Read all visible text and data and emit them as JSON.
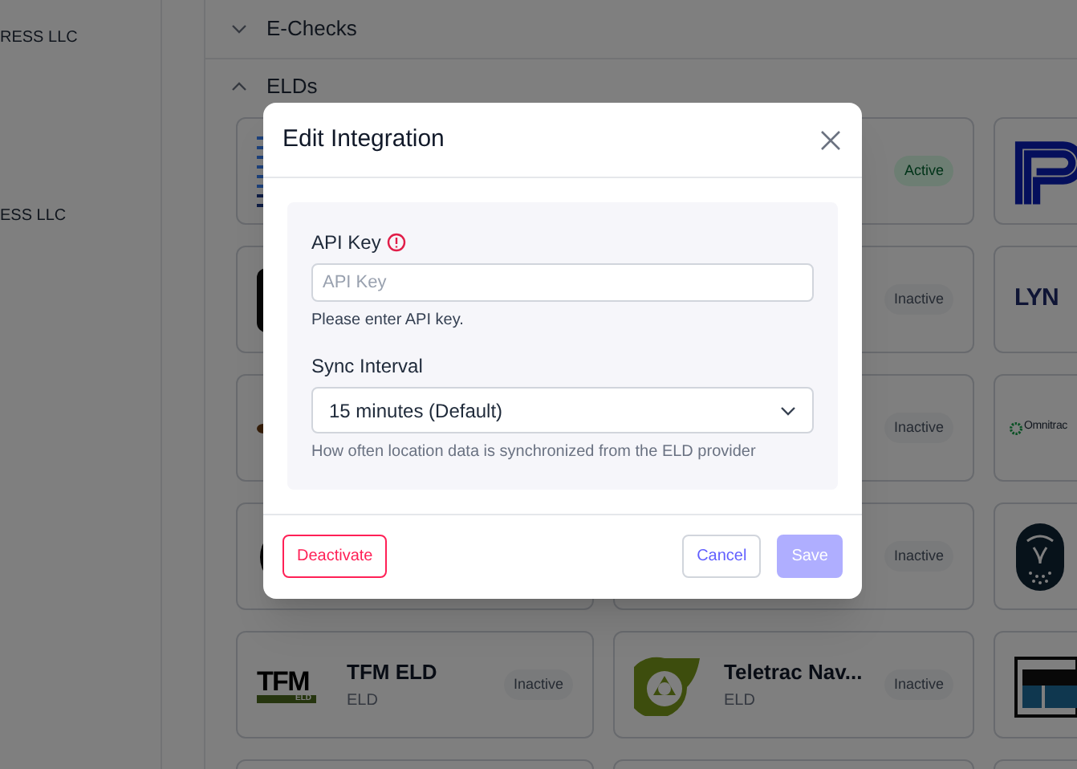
{
  "sidebar": {
    "items": [
      {
        "label": "RESS LLC"
      },
      {
        "label": "ESS LLC"
      }
    ]
  },
  "sections": [
    {
      "title": "E-Checks",
      "expanded": false
    },
    {
      "title": "ELDs",
      "expanded": true,
      "cards": [
        {
          "kind": "stripes"
        },
        {
          "status": "Active",
          "active": true
        },
        {
          "kind": "pmark"
        },
        {
          "kind": "darksquare"
        },
        {
          "status": "Inactive",
          "active": false
        },
        {
          "kind": "textmark",
          "logo_text": "LYN"
        },
        {
          "kind": "brownmark"
        },
        {
          "status": "Inactive",
          "active": false
        },
        {
          "kind": "flowermark",
          "logo_text": "Omnitrac"
        },
        {
          "kind": "darkround"
        },
        {
          "status": "Inactive",
          "active": false
        },
        {
          "kind": "owl"
        },
        {
          "kind": "tfm",
          "logo_text": "TFM",
          "logo_subtext": "ELD",
          "name": "TFM ELD",
          "subtitle": "ELD",
          "status": "Inactive",
          "active": false
        },
        {
          "kind": "teletrac",
          "name": "Teletrac Nav...",
          "subtitle": "ELD",
          "status": "Inactive",
          "active": false
        },
        {
          "kind": "itk"
        },
        {
          "kind": "blank"
        },
        {
          "kind": "blank"
        },
        {
          "kind": "blank"
        }
      ]
    }
  ],
  "modal": {
    "title": "Edit Integration",
    "fields": [
      {
        "kind": "text",
        "label": "API Key",
        "error": true,
        "placeholder": "API Key",
        "message": "Please enter API key."
      },
      {
        "kind": "select",
        "label": "Sync Interval",
        "error": false,
        "value": "15 minutes (Default)",
        "message": "How often location data is synchronized from the ELD provider"
      }
    ],
    "buttons": [
      {
        "kind": "danger",
        "label": "Deactivate",
        "disabled": false
      },
      {
        "kind": "secondary",
        "label": "Cancel",
        "disabled": false
      },
      {
        "kind": "primary",
        "label": "Save",
        "disabled": true
      }
    ]
  }
}
